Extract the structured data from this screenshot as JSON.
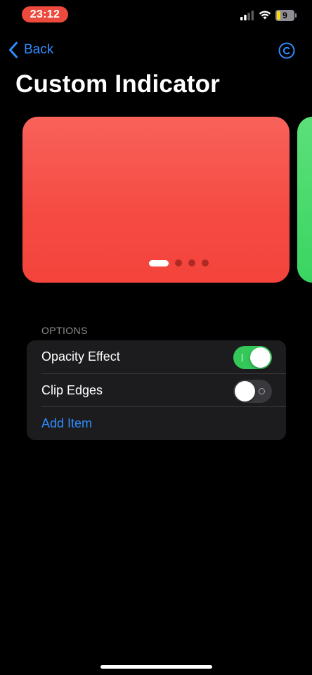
{
  "status_bar": {
    "time": "23:12",
    "battery_level": "9",
    "icons": [
      "signal-icon",
      "wifi-icon",
      "battery-icon"
    ]
  },
  "nav": {
    "back_label": "Back",
    "trailing_icon": "copyright-icon",
    "accent_color": "#2f8cff"
  },
  "title": "Custom Indicator",
  "carousel": {
    "cards": [
      {
        "color": "#f54a42"
      },
      {
        "color": "#3ad462"
      }
    ],
    "page_count": 4,
    "current_page": 1
  },
  "options": {
    "header": "OPTIONS",
    "rows": [
      {
        "label": "Opacity Effect",
        "enabled": true
      },
      {
        "label": "Clip Edges",
        "enabled": false
      }
    ],
    "add_item_label": "Add Item"
  }
}
